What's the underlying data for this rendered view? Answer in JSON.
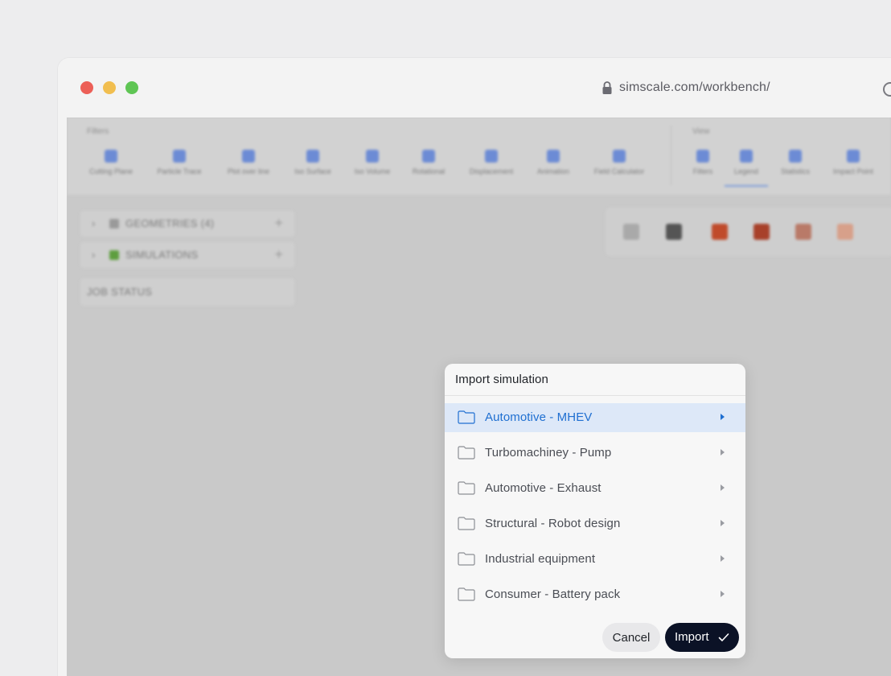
{
  "browser": {
    "url": "simscale.com/workbench/"
  },
  "toolbar": {
    "filters_group_label": "Filters",
    "view_group_label": "View",
    "filters_tools": [
      "Cutting Plane",
      "Particle Trace",
      "Plot over line",
      "Iso Surface",
      "Iso Volume",
      "Rotational",
      "Displacement",
      "Animation",
      "Field Calculator"
    ],
    "view_tools": [
      "Filters",
      "Legend",
      "Statistics",
      "Impact Point"
    ]
  },
  "sidebar": {
    "geometries": "GEOMETRIES (4)",
    "simulations": "SIMULATIONS",
    "job_status": "JOB STATUS"
  },
  "dialog": {
    "title": "Import simulation",
    "items": [
      {
        "label": "Automotive - MHEV",
        "selected": true
      },
      {
        "label": "Turbomachiney - Pump",
        "selected": false
      },
      {
        "label": "Automotive - Exhaust",
        "selected": false
      },
      {
        "label": "Structural - Robot design",
        "selected": false
      },
      {
        "label": "Industrial equipment",
        "selected": false
      },
      {
        "label": "Consumer - Battery pack",
        "selected": false
      }
    ],
    "cancel_label": "Cancel",
    "import_label": "Import"
  },
  "colors": {
    "accent": "#1f6fd1",
    "selected_bg": "#dde8f8",
    "primary_button": "#0b1226"
  }
}
